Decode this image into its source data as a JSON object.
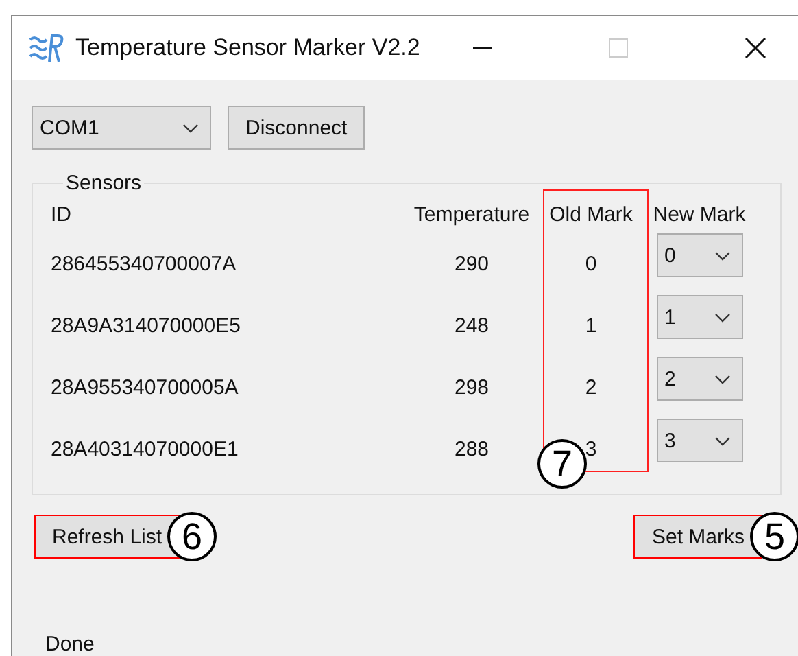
{
  "window": {
    "title": "Temperature Sensor Marker V2.2"
  },
  "port": {
    "value": "COM1"
  },
  "connect_button": {
    "label": "Disconnect"
  },
  "sensors": {
    "title": "Sensors",
    "columns": [
      {
        "label": "ID",
        "highlighted": false
      },
      {
        "label": "Temperature",
        "highlighted": false
      },
      {
        "label": "Old Mark",
        "highlighted": true,
        "callout": "7"
      },
      {
        "label": "New Mark",
        "highlighted": false
      }
    ],
    "rows": [
      {
        "id": "286455340700007A",
        "temperature": "290",
        "old_mark": "0",
        "new_mark": "0"
      },
      {
        "id": "28A9A314070000E5",
        "temperature": "248",
        "old_mark": "1",
        "new_mark": "1"
      },
      {
        "id": "28A955340700005A",
        "temperature": "298",
        "old_mark": "2",
        "new_mark": "2"
      },
      {
        "id": "28A40314070000E1",
        "temperature": "288",
        "old_mark": "3",
        "new_mark": "3"
      }
    ]
  },
  "buttons": [
    {
      "label": "Refresh List",
      "highlighted": true,
      "callout": "6"
    },
    {
      "label": "Set Marks",
      "highlighted": true,
      "callout": "5"
    }
  ],
  "status": "Done"
}
